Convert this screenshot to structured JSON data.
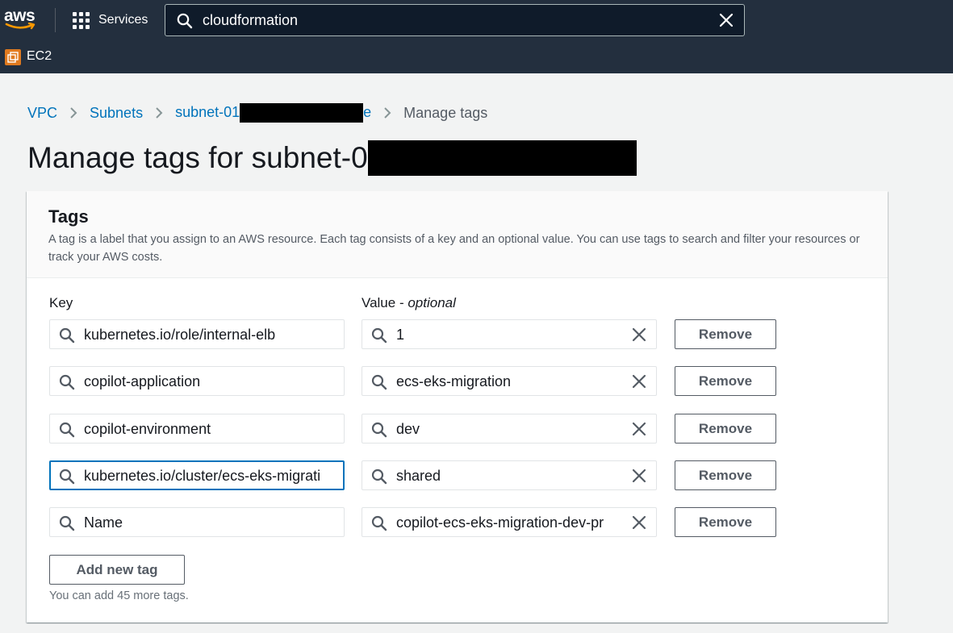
{
  "nav": {
    "logo_text": "aws",
    "services_label": "Services",
    "search_value": "cloudformation",
    "service_label": "EC2"
  },
  "breadcrumb": {
    "items": [
      "VPC",
      "Subnets",
      "subnet-01",
      "e",
      "Manage tags"
    ]
  },
  "page": {
    "title": "Manage tags for subnet-0"
  },
  "tags_panel": {
    "title": "Tags",
    "description": "A tag is a label that you assign to an AWS resource. Each tag consists of a key and an optional value. You can use tags to search and filter your resources or track your AWS costs.",
    "key_label": "Key",
    "value_label": "Value - ",
    "value_label_optional": "optional",
    "rows": [
      {
        "key": "kubernetes.io/role/internal-elb",
        "value": "1"
      },
      {
        "key": "copilot-application",
        "value": "ecs-eks-migration"
      },
      {
        "key": "copilot-environment",
        "value": "dev"
      },
      {
        "key": "kubernetes.io/cluster/ecs-eks-migrati",
        "value": "shared"
      },
      {
        "key": "Name",
        "value": "copilot-ecs-eks-migration-dev-pr"
      }
    ],
    "remove_label": "Remove",
    "add_label": "Add new tag",
    "hint": "You can add 45 more tags."
  },
  "colors": {
    "nav_bg": "#232f3e",
    "link": "#0073bb",
    "focus_border": "#0073bb",
    "ec2_badge": "#e07a1f"
  }
}
